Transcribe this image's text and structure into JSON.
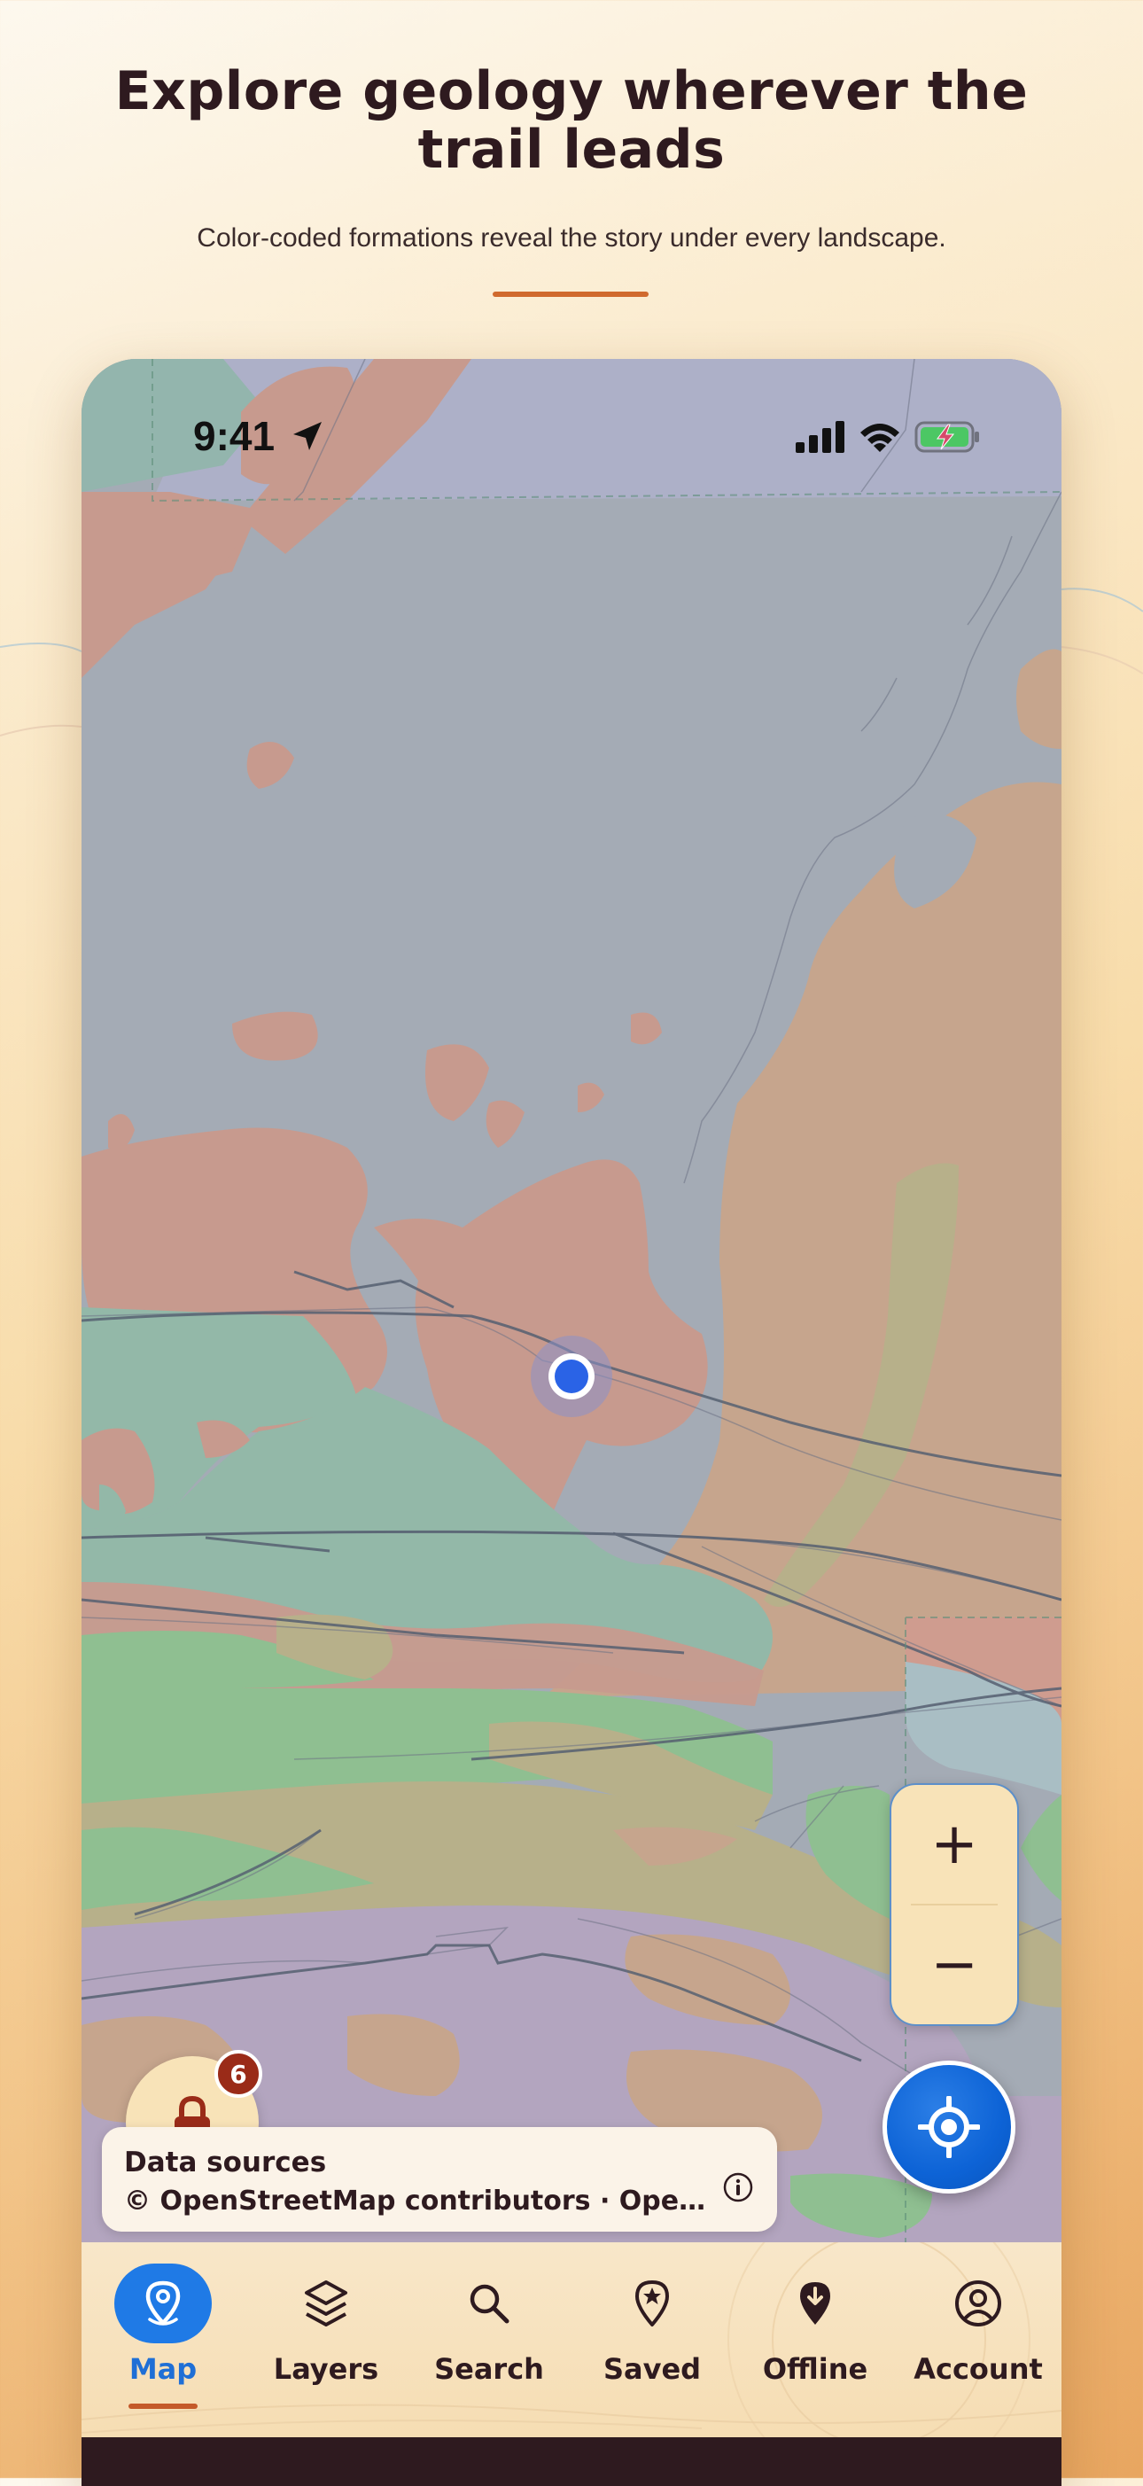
{
  "page": {
    "headline": "Explore geology wherever the trail leads",
    "subhead": "Color-coded formations reveal the story under every landscape."
  },
  "status_bar": {
    "time": "9:41",
    "icons": [
      "location-arrow-icon",
      "signal-bars-icon",
      "wifi-icon",
      "battery-charging-icon"
    ]
  },
  "map": {
    "zoom_in_label": "+",
    "zoom_out_label": "−",
    "locate_icon": "crosshair-icon",
    "lock_icon": "lock-icon",
    "lock_badge_count": "6",
    "formation_colors": {
      "granite": "#cf9c8f",
      "schist": "#a4abb5",
      "sandstone": "#c7a88e",
      "shale": "#93b8a8",
      "greenstone": "#8fbf91",
      "limestone": "#b3a5bf",
      "siltstone": "#b8ac88",
      "slate": "#aaa4c6"
    }
  },
  "data_sources": {
    "title": "Data sources",
    "text": "© OpenStreetMap contributors · OpenTopoMap · Macrostrat",
    "icon": "info-icon"
  },
  "tabs": [
    {
      "label": "Map",
      "icon": "map-pin-icon",
      "active": true
    },
    {
      "label": "Layers",
      "icon": "layers-icon",
      "active": false
    },
    {
      "label": "Search",
      "icon": "search-icon",
      "active": false
    },
    {
      "label": "Saved",
      "icon": "saved-star-pin-icon",
      "active": false
    },
    {
      "label": "Offline",
      "icon": "download-pin-icon",
      "active": false
    },
    {
      "label": "Account",
      "icon": "account-icon",
      "active": false
    }
  ],
  "colors": {
    "accent": "#1f7ae6",
    "headline": "#2e1a1f",
    "accent_bar": "#d06a2e",
    "badge": "#9a2b18"
  }
}
